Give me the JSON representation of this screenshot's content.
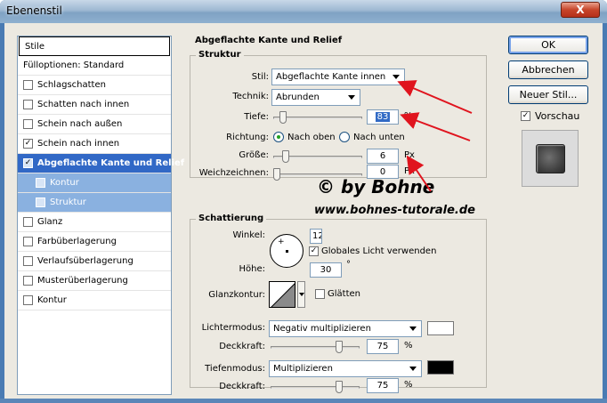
{
  "window": {
    "title": "Ebenenstil",
    "close_label": "X"
  },
  "styles_list": {
    "header": "Stile",
    "items": [
      {
        "label": "Fülloptionen: Standard",
        "kind": "plain"
      },
      {
        "label": "Schlagschatten",
        "kind": "check",
        "checked": false
      },
      {
        "label": "Schatten nach innen",
        "kind": "check",
        "checked": false
      },
      {
        "label": "Schein nach außen",
        "kind": "check",
        "checked": false
      },
      {
        "label": "Schein nach innen",
        "kind": "check",
        "checked": true
      },
      {
        "label": "Abgeflachte Kante und Relief",
        "kind": "selected",
        "checked": true
      },
      {
        "label": "Kontur",
        "kind": "sub",
        "checked": false
      },
      {
        "label": "Struktur",
        "kind": "sub",
        "checked": false
      },
      {
        "label": "Glanz",
        "kind": "check",
        "checked": false
      },
      {
        "label": "Farbüberlagerung",
        "kind": "check",
        "checked": false
      },
      {
        "label": "Verlaufsüberlagerung",
        "kind": "check",
        "checked": false
      },
      {
        "label": "Musterüberlagerung",
        "kind": "check",
        "checked": false
      },
      {
        "label": "Kontur",
        "kind": "check",
        "checked": false
      }
    ]
  },
  "bevel": {
    "group_title": "Abgeflachte Kante und Relief",
    "structure": {
      "legend": "Struktur",
      "style_label": "Stil:",
      "style_value": "Abgeflachte Kante innen",
      "technique_label": "Technik:",
      "technique_value": "Abrunden",
      "depth_label": "Tiefe:",
      "depth_value": "83",
      "depth_level_percent": 8,
      "depth_unit": "%",
      "direction_label": "Richtung:",
      "direction_up": "Nach oben",
      "direction_down": "Nach unten",
      "size_label": "Größe:",
      "size_value": "6",
      "size_unit": "Px",
      "soften_label": "Weichzeichnen:",
      "soften_value": "0",
      "soften_unit": "Px"
    },
    "shading": {
      "legend": "Schattierung",
      "angle_label": "Winkel:",
      "angle_value": "12",
      "global_light_label": "Globales Licht verwenden",
      "altitude_label": "Höhe:",
      "altitude_value": "30",
      "altitude_unit": "°",
      "gloss_label": "Glanzkontur:",
      "antialias_label": "Glätten",
      "highlight_mode_label": "Lichtermodus:",
      "highlight_mode_value": "Negativ multiplizieren",
      "highlight_color": "#ffffff",
      "highlight_opacity_label": "Deckkraft:",
      "highlight_opacity_value": "75",
      "shadow_mode_label": "Tiefenmodus:",
      "shadow_mode_value": "Multiplizieren",
      "shadow_color": "#000000",
      "shadow_opacity_label": "Deckkraft:",
      "shadow_opacity_value": "75",
      "percent": "%"
    }
  },
  "buttons": {
    "ok": "OK",
    "cancel": "Abbrechen",
    "new_style": "Neuer Stil...",
    "preview": "Vorschau"
  },
  "watermark": {
    "line1": "© by Bohne",
    "line2": "www.bohnes-tutorale.de"
  },
  "colors": {
    "annotation": "#e0141e",
    "selection": "#3168c6"
  }
}
